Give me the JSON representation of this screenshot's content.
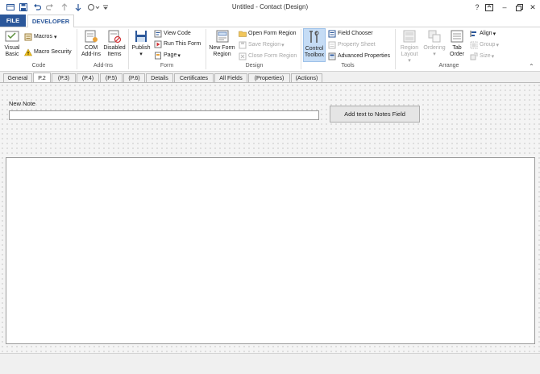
{
  "window": {
    "title": "Untitled - Contact  (Design)",
    "controls": {
      "help": "?",
      "minimize": "–",
      "close": "✕"
    }
  },
  "ribbon_tabs": {
    "file": "FILE",
    "developer": "DEVELOPER"
  },
  "ribbon": {
    "code": {
      "label": "Code",
      "visual_basic": "Visual Basic",
      "macros": "Macros",
      "macro_security": "Macro Security"
    },
    "addins": {
      "label": "Add-Ins",
      "com_addins": "COM Add-Ins",
      "disabled_items": "Disabled Items"
    },
    "form": {
      "label": "Form",
      "publish": "Publish",
      "view_code": "View Code",
      "run_this_form": "Run This Form",
      "page": "Page"
    },
    "design": {
      "label": "Design",
      "new_form_region": "New Form Region",
      "open_form_region": "Open Form Region",
      "save_region": "Save Region",
      "close_form_region": "Close Form Region"
    },
    "tools": {
      "label": "Tools",
      "control_toolbox": "Control Toolbox",
      "field_chooser": "Field Chooser",
      "property_sheet": "Property Sheet",
      "advanced_properties": "Advanced Properties"
    },
    "arrange": {
      "label": "Arrange",
      "region_layout": "Region Layout",
      "ordering": "Ordering",
      "tab_order": "Tab Order",
      "align": "Align",
      "group": "Group",
      "size": "Size"
    }
  },
  "form_tabs": [
    {
      "label": "General",
      "active": false
    },
    {
      "label": "P.2",
      "active": true
    },
    {
      "label": "(P.3)",
      "active": false
    },
    {
      "label": "(P.4)",
      "active": false
    },
    {
      "label": "(P.5)",
      "active": false
    },
    {
      "label": "(P.6)",
      "active": false
    },
    {
      "label": "Details",
      "active": false
    },
    {
      "label": "Certificates",
      "active": false
    },
    {
      "label": "All Fields",
      "active": false
    },
    {
      "label": "(Properties)",
      "active": false
    },
    {
      "label": "(Actions)",
      "active": false
    }
  ],
  "form": {
    "new_note_label": "New Note",
    "new_note_value": "",
    "add_button": "Add text to Notes Field",
    "notes_value": ""
  },
  "colors": {
    "accent": "#2b579a",
    "pressed": "#c5dcf5",
    "grid": "#f4f4f4"
  }
}
